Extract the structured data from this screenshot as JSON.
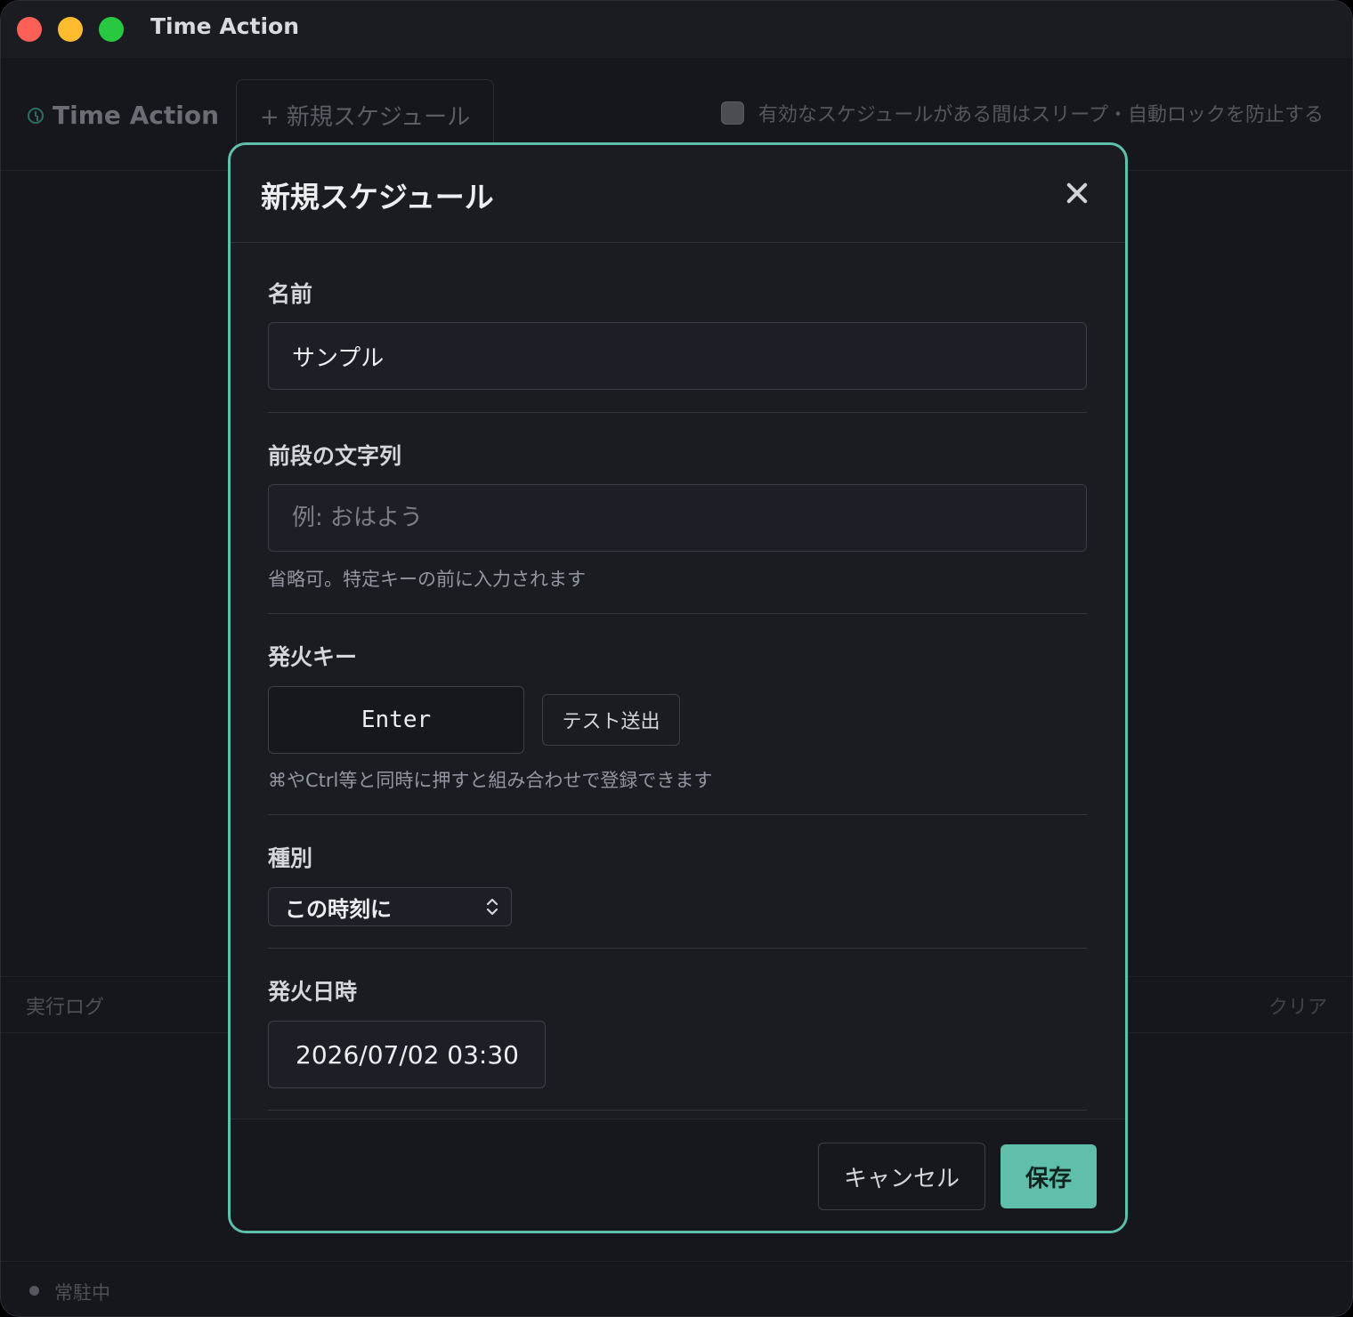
{
  "window": {
    "title": "Time Action"
  },
  "app": {
    "brand": "Time Action",
    "new_schedule_button": "+ 新規スケジュール",
    "prevent_sleep_label": "有効なスケジュールがある間はスリープ・自動ロックを防止する",
    "log_title": "実行ログ",
    "log_clear": "クリア",
    "status": "常駐中"
  },
  "modal": {
    "title": "新規スケジュール",
    "name": {
      "label": "名前",
      "value": "サンプル"
    },
    "prefix": {
      "label": "前段の文字列",
      "placeholder": "例: おはよう",
      "hint": "省略可。特定キーの前に入力されます"
    },
    "trigger_key": {
      "label": "発火キー",
      "value": "Enter",
      "test_button": "テスト送出",
      "hint": "⌘やCtrl等と同時に押すと組み合わせで登録できます"
    },
    "type": {
      "label": "種別",
      "selected": "この時刻に"
    },
    "datetime": {
      "label": "発火日時",
      "value": "2026/07/02 03:30"
    },
    "cancel_button": "キャンセル",
    "save_button": "保存"
  },
  "colors": {
    "accent": "#5fbfab",
    "background": "#16171c"
  }
}
